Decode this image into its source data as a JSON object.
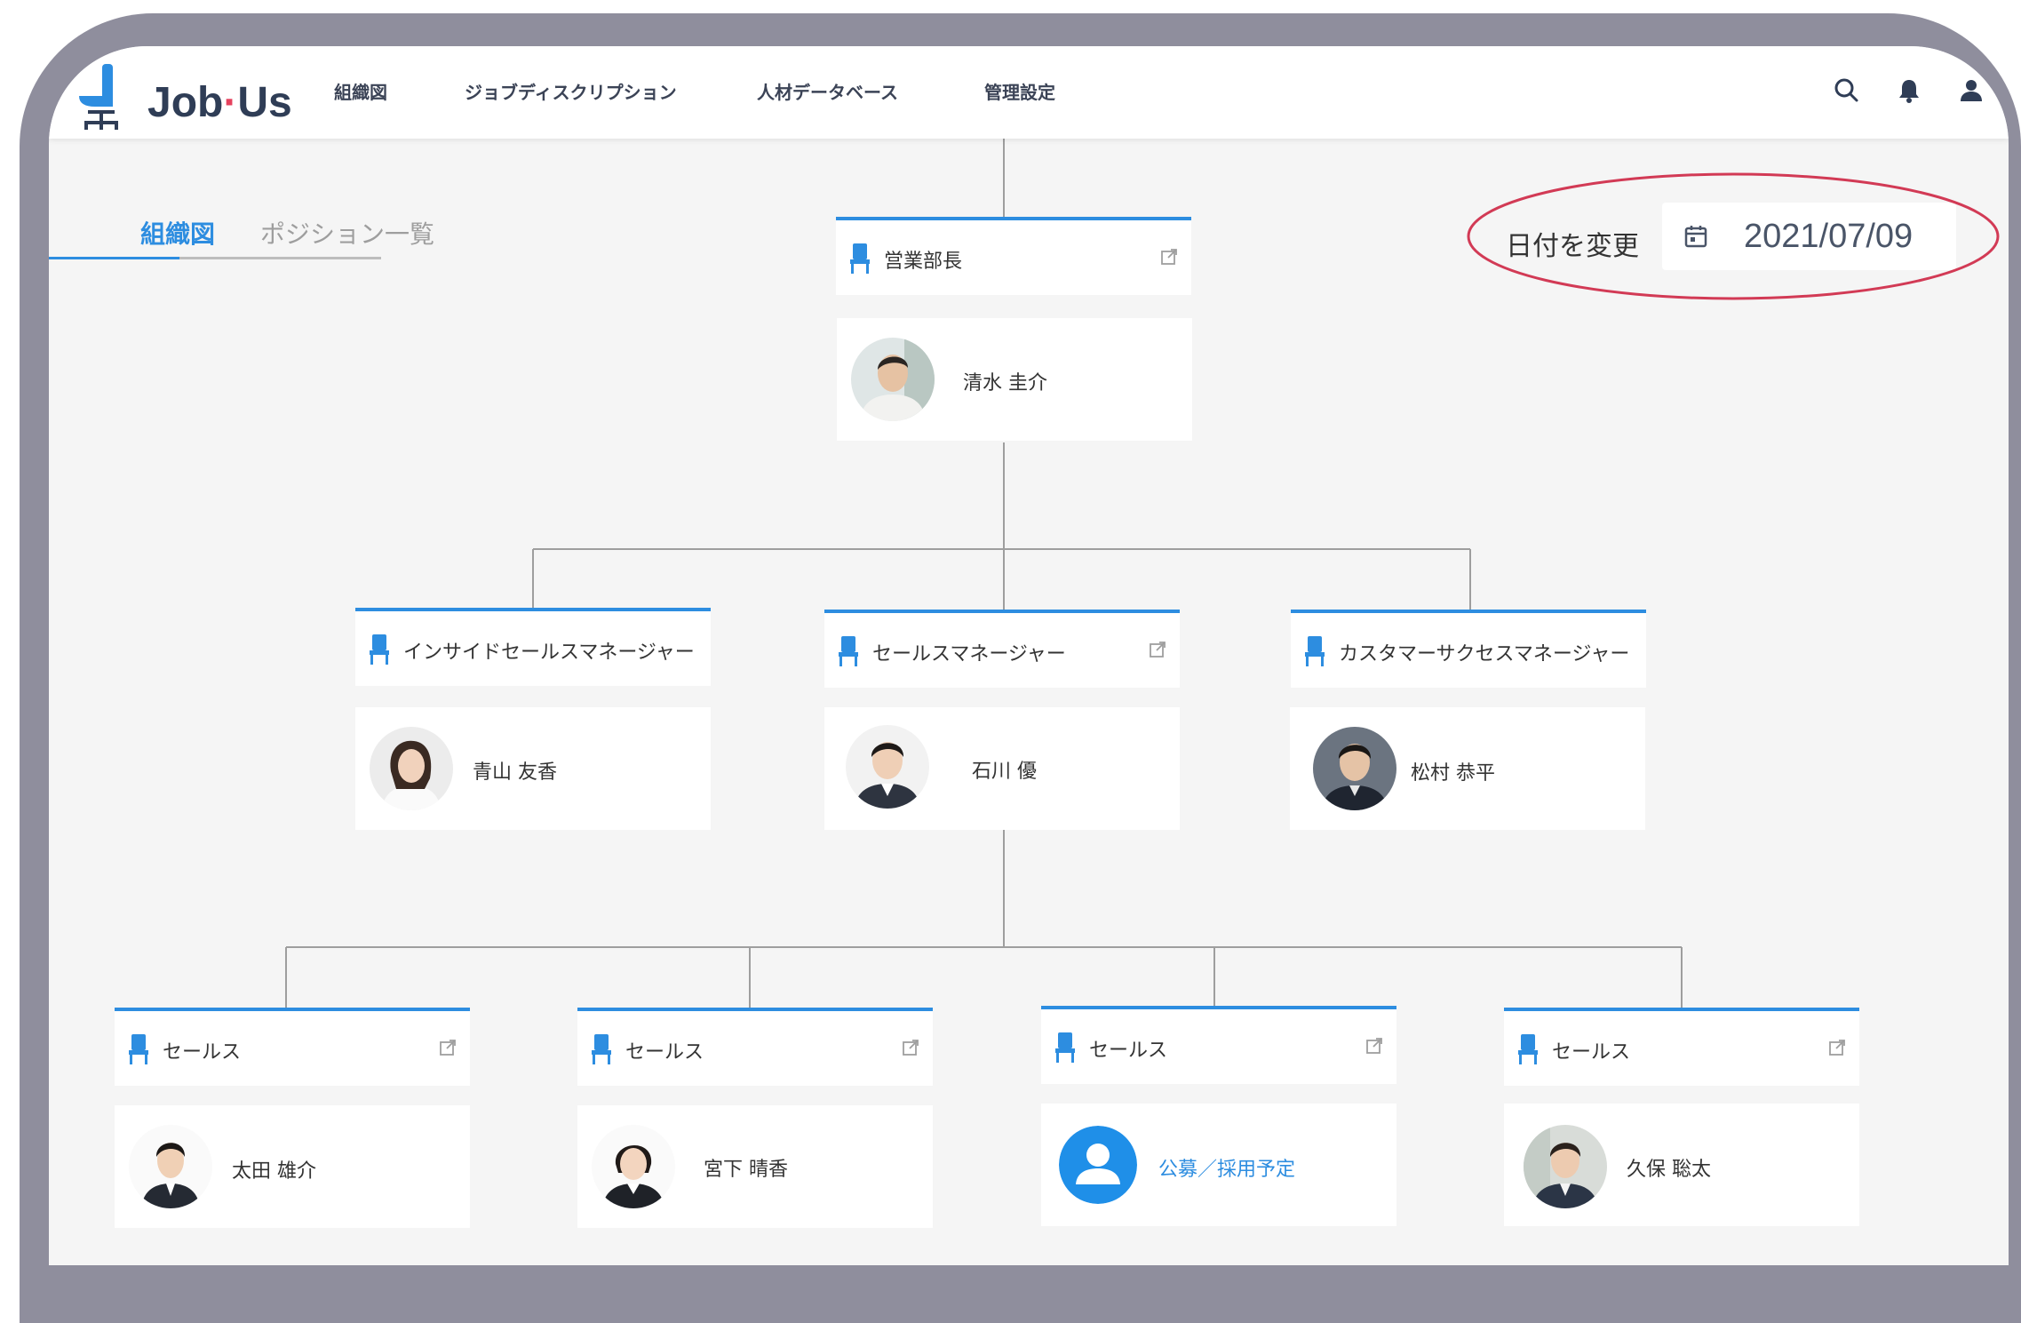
{
  "app": {
    "logo_text_left": "Job",
    "logo_dot": "·",
    "logo_text_right": "Us",
    "brand_color": "#2d8de0"
  },
  "nav": {
    "items": [
      {
        "label": "組織図"
      },
      {
        "label": "ジョブディスクリプション"
      },
      {
        "label": "人材データベース"
      },
      {
        "label": "管理設定"
      }
    ],
    "icons": [
      "search-icon",
      "bell-icon",
      "user-icon"
    ]
  },
  "tabs": [
    {
      "label": "組織図",
      "active": true
    },
    {
      "label": "ポジション一覧",
      "active": false
    }
  ],
  "date_picker": {
    "label": "日付を変更",
    "value": "2021/07/09",
    "icon": "calendar-icon"
  },
  "org": {
    "root": {
      "position": "営業部長",
      "person": "清水 圭介"
    },
    "level2": [
      {
        "position": "インサイドセールスマネージャー",
        "person": "青山 友香"
      },
      {
        "position": "セールスマネージャー",
        "person": "石川 優"
      },
      {
        "position": "カスタマーサクセスマネージャー",
        "person": "松村 恭平"
      }
    ],
    "level3": [
      {
        "position": "セールス",
        "person": "太田 雄介"
      },
      {
        "position": "セールス",
        "person": "宮下 晴香"
      },
      {
        "position": "セールス",
        "person": "公募／採用予定",
        "vacant": true
      },
      {
        "position": "セールス",
        "person": "久保 聡太"
      }
    ]
  }
}
